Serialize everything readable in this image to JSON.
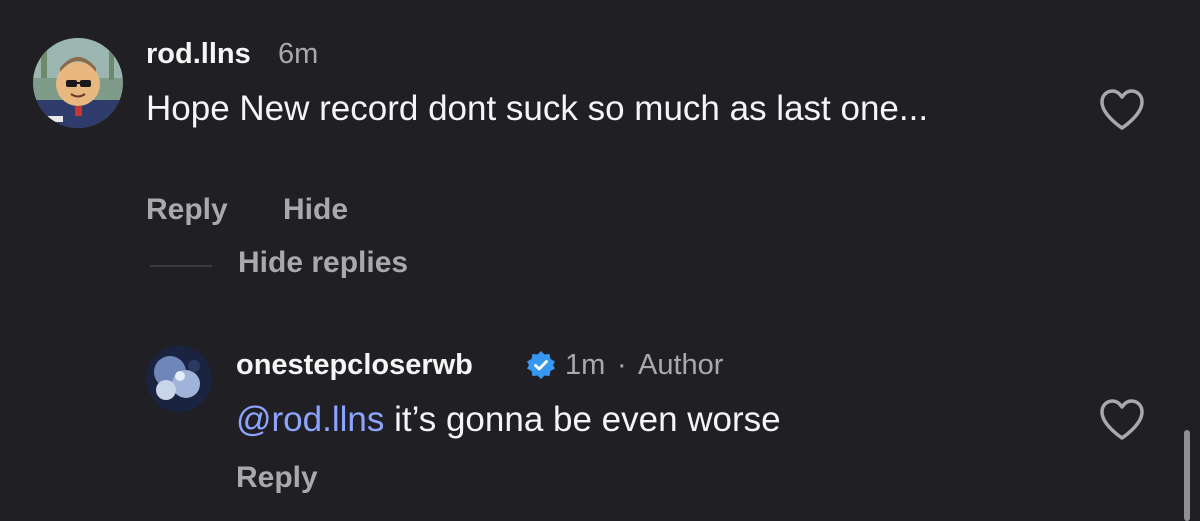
{
  "comment": {
    "username": "rod.llns",
    "time": "6m",
    "text": "Hope New record dont suck so much as last one...",
    "actions": {
      "reply": "Reply",
      "hide": "Hide"
    },
    "like_icon": "heart-outline-icon"
  },
  "replies_toggle": {
    "label": "Hide replies"
  },
  "reply": {
    "username": "onestepcloserwb",
    "verified_icon": "verified-badge-icon",
    "time": "1m",
    "separator": "·",
    "role": "Author",
    "mention": "@rod.llns",
    "text": " it’s gonna be even worse",
    "actions": {
      "reply": "Reply"
    },
    "like_icon": "heart-outline-icon"
  },
  "colors": {
    "background": "#1f1f24",
    "text_primary": "#f5f5f5",
    "text_secondary": "#a8a8ad",
    "mention": "#8da4ff",
    "verified": "#3897f0"
  }
}
